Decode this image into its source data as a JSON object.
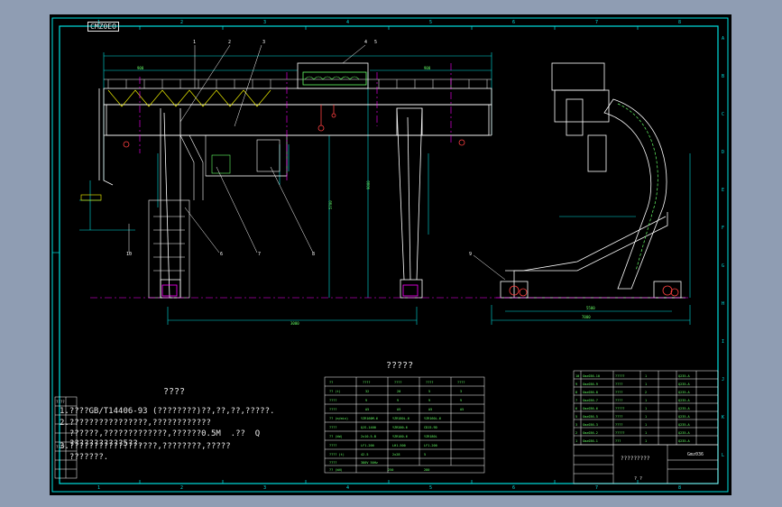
{
  "drawing": {
    "stamp": "CMZ0EO",
    "notes_heading": "????",
    "notes": [
      "1.????GB/T14406-93 (????????)??,??,??,?????.",
      "2.????????????????,????????????",
      "  ??????,?????????????,??????0.5M  .??  Q",
      "  ???????????5??.",
      "3.??????????????????,????????,?????",
      "  ???????."
    ],
    "spec_table_title": "?????",
    "parts_title": "Gmz036",
    "title_block": "?????????",
    "title_block_small": "? ?",
    "left_revision": [
      "????",
      "????"
    ],
    "callouts": [
      "1",
      "2",
      "3",
      "4",
      "5",
      "6",
      "7",
      "8",
      "9",
      "10"
    ],
    "border_numbers": [
      "1",
      "2",
      "3",
      "4",
      "5",
      "6",
      "7",
      "8"
    ],
    "border_letters": [
      "A",
      "B",
      "C",
      "D",
      "E",
      "F",
      "G",
      "H",
      "I",
      "J",
      "K",
      "L"
    ]
  },
  "colors": {
    "window_bg": "#8f9db3",
    "sheet_bg": "#000000",
    "structure": "#ffffff",
    "dimension": "#00e0e0",
    "centerline": "#ff00ff",
    "rail": "#e000e0",
    "equipment": "#66ff66",
    "hook": "#ff4040"
  }
}
